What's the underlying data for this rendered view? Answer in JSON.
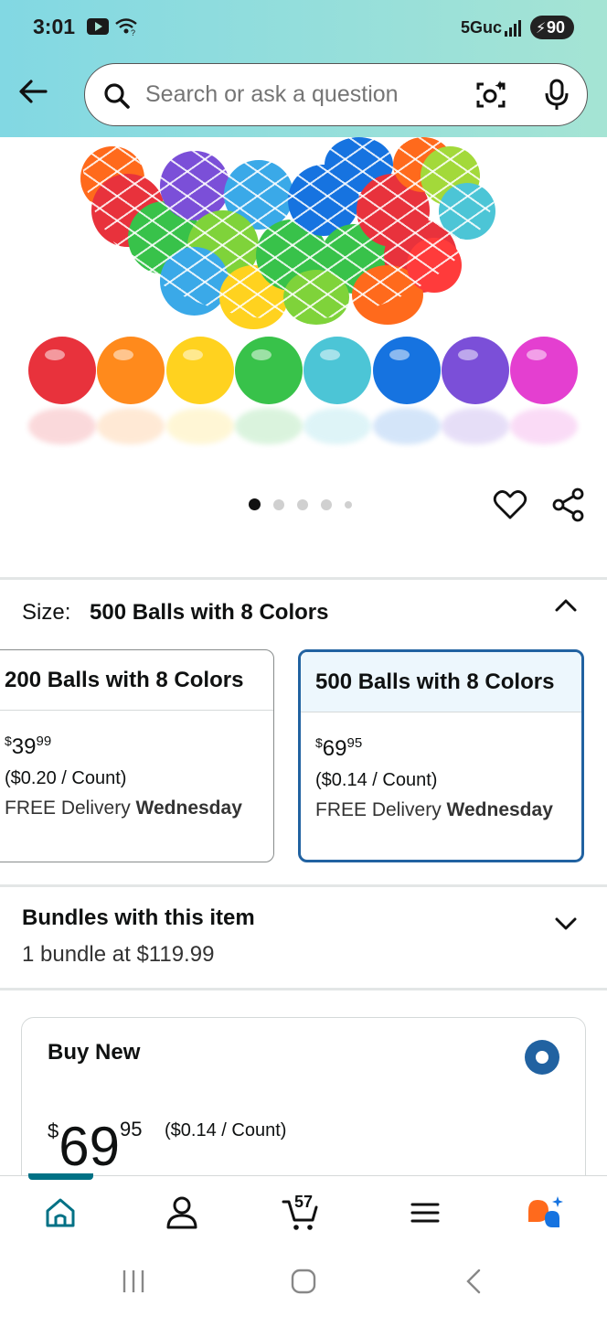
{
  "status_bar": {
    "time": "3:01",
    "network": "5Guc",
    "battery": "90"
  },
  "search": {
    "placeholder": "Search or ask a question"
  },
  "gallery": {
    "dot_count": 5,
    "active_index": 0
  },
  "size": {
    "label": "Size:",
    "selected_value": "500 Balls with 8 Colors",
    "options": [
      {
        "title": "200 Balls with 8 Colors",
        "price_dollars": "39",
        "price_cents": "99",
        "currency": "$",
        "per_count": "($0.20 / Count)",
        "delivery_prefix": "FREE Delivery",
        "delivery_day": "Wednesday",
        "selected": false
      },
      {
        "title": "500 Balls with 8 Colors",
        "price_dollars": "69",
        "price_cents": "95",
        "currency": "$",
        "per_count": "($0.14 / Count)",
        "delivery_prefix": "FREE Delivery",
        "delivery_day": "Wednesday",
        "selected": true
      }
    ]
  },
  "bundles": {
    "title": "Bundles with this item",
    "subtitle": "1 bundle at $119.99"
  },
  "buy_new": {
    "title": "Buy New",
    "currency": "$",
    "price_dollars": "69",
    "price_cents": "95",
    "per_count": "($0.14 / Count)"
  },
  "bottom_nav": {
    "cart_count": "57",
    "accent_color": "#007185"
  },
  "colors": {
    "selected_border": "#2162a1",
    "ball_row": [
      "#e8323c",
      "#ff8a1c",
      "#ffd21f",
      "#38c24a",
      "#4cc5d6",
      "#1673e0",
      "#7b4fd8",
      "#e43fd0"
    ]
  }
}
